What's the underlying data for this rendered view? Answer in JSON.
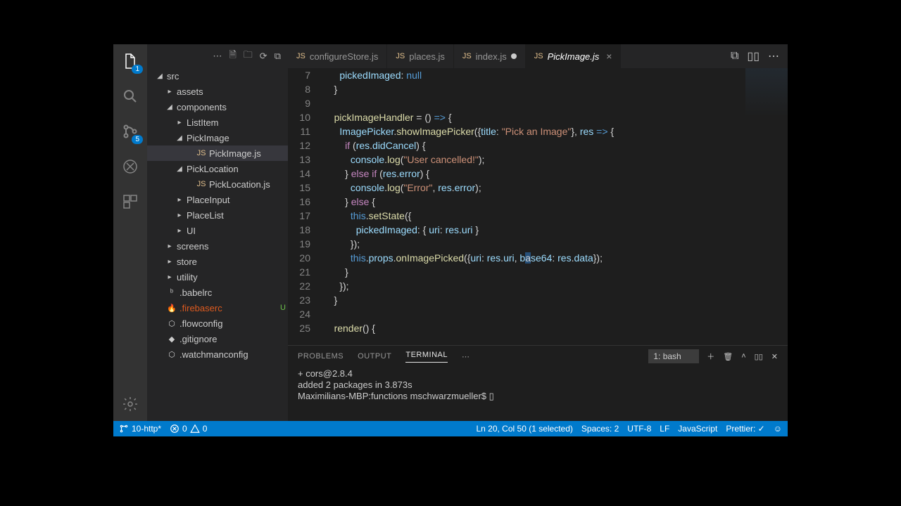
{
  "activity": {
    "explorerBadge": "1",
    "scmBadge": "5"
  },
  "tabs": [
    {
      "label": "configureStore.js",
      "icon": "JS",
      "active": false,
      "dirty": false
    },
    {
      "label": "places.js",
      "icon": "JS",
      "active": false,
      "dirty": false
    },
    {
      "label": "index.js",
      "icon": "JS",
      "active": false,
      "dirty": true
    },
    {
      "label": "PickImage.js",
      "icon": "JS",
      "active": true,
      "dirty": false
    }
  ],
  "tree": [
    {
      "indent": 12,
      "chev": "◢",
      "label": "src"
    },
    {
      "indent": 26,
      "chev": "▸",
      "label": "assets"
    },
    {
      "indent": 26,
      "chev": "◢",
      "label": "components"
    },
    {
      "indent": 40,
      "chev": "▸",
      "label": "ListItem"
    },
    {
      "indent": 40,
      "chev": "◢",
      "label": "PickImage"
    },
    {
      "indent": 54,
      "chev": "",
      "ficon": "JS",
      "label": "PickImage.js",
      "active": true,
      "js": true
    },
    {
      "indent": 40,
      "chev": "◢",
      "label": "PickLocation"
    },
    {
      "indent": 54,
      "chev": "",
      "ficon": "JS",
      "label": "PickLocation.js",
      "js": true
    },
    {
      "indent": 40,
      "chev": "▸",
      "label": "PlaceInput"
    },
    {
      "indent": 40,
      "chev": "▸",
      "label": "PlaceList"
    },
    {
      "indent": 40,
      "chev": "▸",
      "label": "UI"
    },
    {
      "indent": 26,
      "chev": "▸",
      "label": "screens"
    },
    {
      "indent": 26,
      "chev": "▸",
      "label": "store"
    },
    {
      "indent": 26,
      "chev": "▸",
      "label": "utility"
    },
    {
      "indent": 12,
      "chev": "",
      "ficon": "ᵇ",
      "label": ".babelrc"
    },
    {
      "indent": 12,
      "chev": "",
      "ficon": "🔥",
      "label": ".firebaserc",
      "fire": true,
      "status": "U"
    },
    {
      "indent": 12,
      "chev": "",
      "ficon": "⬡",
      "label": ".flowconfig"
    },
    {
      "indent": 12,
      "chev": "",
      "ficon": "◆",
      "label": ".gitignore"
    },
    {
      "indent": 12,
      "chev": "",
      "ficon": "⬡",
      "label": ".watchmanconfig"
    }
  ],
  "lineStart": 7,
  "code": [
    {
      "n": 7,
      "h": "      <span class='k-var'>pickedImaged</span>: <span class='k-null'>null</span>"
    },
    {
      "n": 8,
      "h": "    }"
    },
    {
      "n": 9,
      "h": ""
    },
    {
      "n": 10,
      "h": "    <span class='k-fn'>pickImageHandler</span> = () <span class='k-null'>=&gt;</span> {"
    },
    {
      "n": 11,
      "h": "      <span class='k-var'>ImagePicker</span>.<span class='k-fn'>showImagePicker</span>({<span class='k-var'>title</span>: <span class='k-str'>\"Pick an Image\"</span>}, <span class='k-var'>res</span> <span class='k-null'>=&gt;</span> {"
    },
    {
      "n": 12,
      "h": "        <span class='k-kw'>if</span> (<span class='k-var'>res</span>.<span class='k-var'>didCancel</span>) {"
    },
    {
      "n": 13,
      "h": "          <span class='k-var'>console</span>.<span class='k-fn'>log</span>(<span class='k-str'>\"User cancelled!\"</span>);"
    },
    {
      "n": 14,
      "h": "        } <span class='k-kw'>else if</span> (<span class='k-var'>res</span>.<span class='k-var'>error</span>) {"
    },
    {
      "n": 15,
      "h": "          <span class='k-var'>console</span>.<span class='k-fn'>log</span>(<span class='k-str'>\"Error\"</span>, <span class='k-var'>res</span>.<span class='k-var'>error</span>);"
    },
    {
      "n": 16,
      "h": "        } <span class='k-kw'>else</span> {"
    },
    {
      "n": 17,
      "h": "          <span class='k-this'>this</span>.<span class='k-fn'>setState</span>({"
    },
    {
      "n": 18,
      "h": "            <span class='k-var'>pickedImaged</span>: { <span class='k-var'>uri</span>: <span class='k-var'>res</span>.<span class='k-var'>uri</span> }"
    },
    {
      "n": 19,
      "h": "          });"
    },
    {
      "n": 20,
      "h": "          <span class='k-this'>this</span>.<span class='k-var'>props</span>.<span class='k-fn'>onImagePicked</span>({<span class='k-var'>uri</span>: <span class='k-var'>res</span>.<span class='k-var'>uri</span>, <span class='k-var'>b</span><span class='k-sel'>a</span><span class='k-var'>se64</span>: <span class='k-var'>res</span>.<span class='k-var'>data</span>});"
    },
    {
      "n": 21,
      "h": "        }"
    },
    {
      "n": 22,
      "h": "      });"
    },
    {
      "n": 23,
      "h": "    }"
    },
    {
      "n": 24,
      "h": ""
    },
    {
      "n": 25,
      "h": "    <span class='k-fn'>render</span>() {"
    }
  ],
  "panel": {
    "tabs": {
      "problems": "PROBLEMS",
      "output": "OUTPUT",
      "terminal": "TERMINAL"
    },
    "select": "1: bash",
    "lines": [
      "+ cors@2.8.4",
      "added 2 packages in 3.873s",
      "Maximilians-MBP:functions mschwarzmueller$ ▯"
    ]
  },
  "status": {
    "branch": "10-http*",
    "errors": "0",
    "warnings": "0",
    "cursor": "Ln 20, Col 50 (1 selected)",
    "spaces": "Spaces: 2",
    "encoding": "UTF-8",
    "eol": "LF",
    "lang": "JavaScript",
    "prettier": "Prettier: ✓"
  }
}
